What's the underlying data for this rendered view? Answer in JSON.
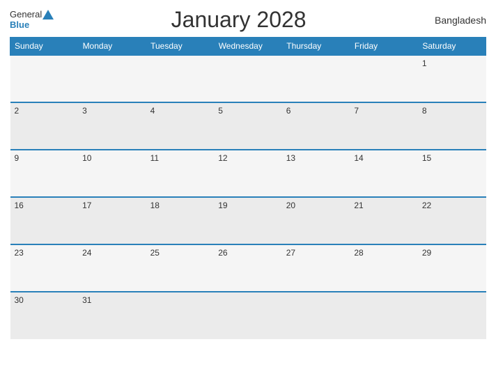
{
  "header": {
    "logo_general": "General",
    "logo_blue": "Blue",
    "title": "January 2028",
    "country": "Bangladesh"
  },
  "weekdays": [
    "Sunday",
    "Monday",
    "Tuesday",
    "Wednesday",
    "Thursday",
    "Friday",
    "Saturday"
  ],
  "weeks": [
    [
      "",
      "",
      "",
      "",
      "",
      "",
      "1"
    ],
    [
      "2",
      "3",
      "4",
      "5",
      "6",
      "7",
      "8"
    ],
    [
      "9",
      "10",
      "11",
      "12",
      "13",
      "14",
      "15"
    ],
    [
      "16",
      "17",
      "18",
      "19",
      "20",
      "21",
      "22"
    ],
    [
      "23",
      "24",
      "25",
      "26",
      "27",
      "28",
      "29"
    ],
    [
      "30",
      "31",
      "",
      "",
      "",
      "",
      ""
    ]
  ]
}
